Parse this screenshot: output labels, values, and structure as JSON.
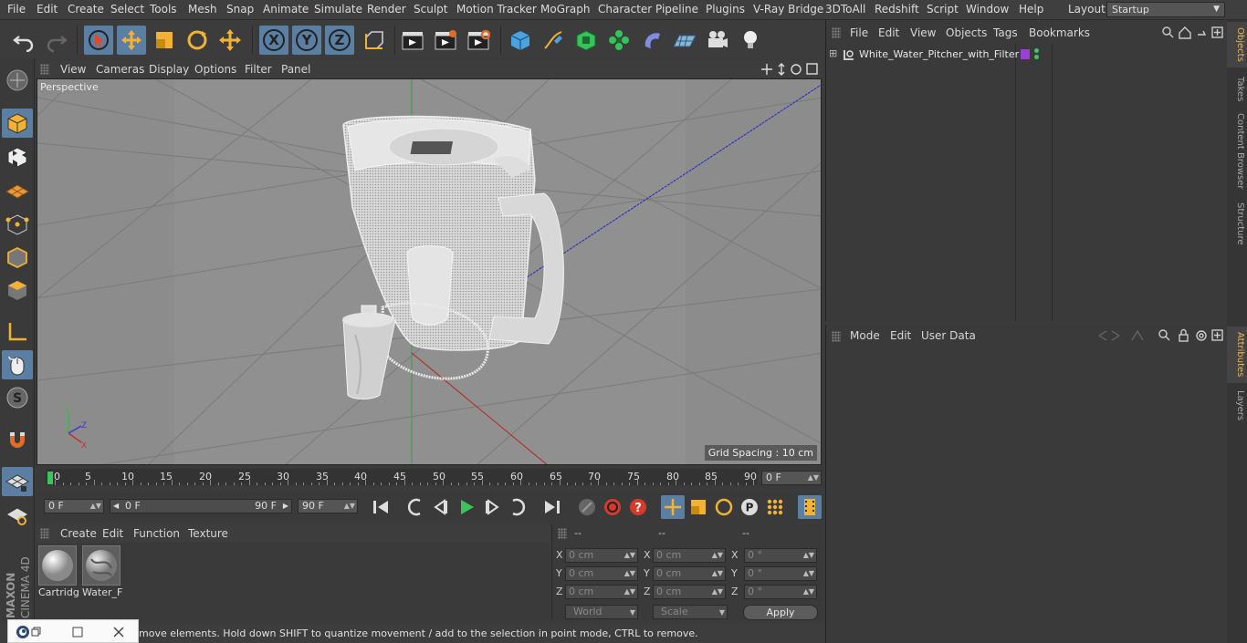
{
  "menubar": {
    "items": [
      "File",
      "Edit",
      "Create",
      "Select",
      "Tools",
      "Mesh",
      "Snap",
      "Animate",
      "Simulate",
      "Render",
      "Sculpt",
      "Motion Tracker",
      "MoGraph",
      "Character",
      "Pipeline",
      "Plugins",
      "V-Ray Bridge",
      "3DToAll",
      "Redshift",
      "Script",
      "Window",
      "Help"
    ],
    "layout_label": "Layout:",
    "layout_value": "Startup"
  },
  "viewport": {
    "menu": [
      "View",
      "Cameras",
      "Display",
      "Options",
      "Filter",
      "Panel"
    ],
    "label": "Perspective",
    "grid_spacing": "Grid Spacing : 10 cm"
  },
  "timeline": {
    "ticks": [
      "0",
      "5",
      "10",
      "15",
      "20",
      "25",
      "30",
      "35",
      "40",
      "45",
      "50",
      "55",
      "60",
      "65",
      "70",
      "75",
      "80",
      "85",
      "90"
    ],
    "current_frame": "0 F",
    "start_field": "0 F",
    "range_start": "0 F",
    "range_end": "90 F",
    "end_field": "90 F"
  },
  "materials": {
    "menu": [
      "Create",
      "Edit",
      "Function",
      "Texture"
    ],
    "items": [
      "Cartridg",
      "Water_F"
    ]
  },
  "coords": {
    "headers": [
      "--",
      "--",
      "--"
    ],
    "rows": [
      {
        "axis": "X",
        "pos": "0 cm",
        "size": "0 cm",
        "rot_axis": "X",
        "rot": "0 °"
      },
      {
        "axis": "Y",
        "pos": "0 cm",
        "size": "0 cm",
        "rot_axis": "Y",
        "rot": "0 °"
      },
      {
        "axis": "Z",
        "pos": "0 cm",
        "size": "0 cm",
        "rot_axis": "Z",
        "rot": "0 °"
      }
    ],
    "world": "World",
    "scale": "Scale",
    "apply": "Apply"
  },
  "status": {
    "text": "move elements. Hold down SHIFT to quantize movement / add to the selection in point mode, CTRL to remove."
  },
  "objects": {
    "menu": [
      "File",
      "Edit",
      "View",
      "Objects",
      "Tags",
      "Bookmarks"
    ],
    "items": [
      {
        "name": "White_Water_Pitcher_with_Filter"
      }
    ]
  },
  "attributes": {
    "menu": [
      "Mode",
      "Edit",
      "User Data"
    ]
  },
  "right_tabs": [
    "Objects",
    "Takes",
    "Content Browser",
    "Structure",
    "Attributes",
    "Layers"
  ],
  "brand": {
    "line1": "MAXON",
    "line2": "CINEMA 4D"
  },
  "colors": {
    "accent": "#5a7fa3",
    "tab_active": "#e4b95a",
    "tag_purple": "#9b3fd6",
    "tag_green": "#3fc46a"
  }
}
